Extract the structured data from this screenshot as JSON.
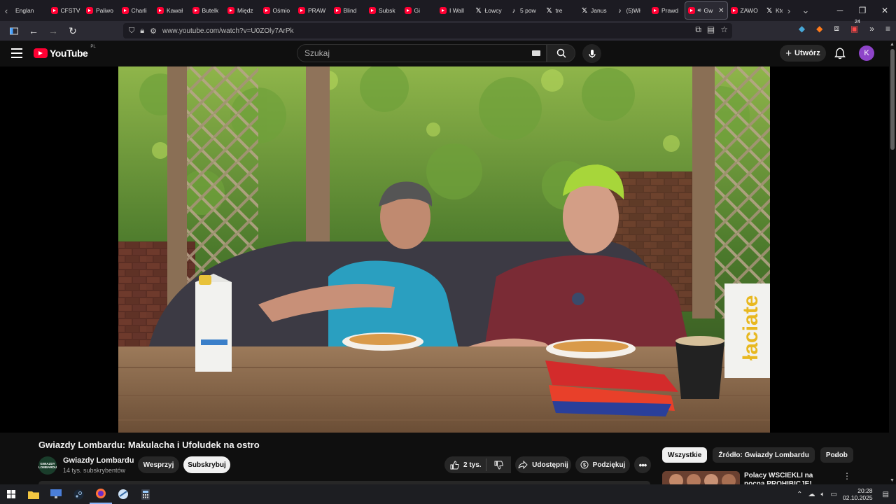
{
  "browser": {
    "tabs": [
      {
        "label": "Englan",
        "icon": "nav-back-icon"
      },
      {
        "label": "CFSTV",
        "icon": "youtube-icon"
      },
      {
        "label": "Paliwo",
        "icon": "youtube-icon"
      },
      {
        "label": "Charli",
        "icon": "youtube-icon"
      },
      {
        "label": "Kawał",
        "icon": "youtube-icon"
      },
      {
        "label": "Butelk",
        "icon": "youtube-icon"
      },
      {
        "label": "Międz",
        "icon": "youtube-icon"
      },
      {
        "label": "Ośmio",
        "icon": "youtube-icon"
      },
      {
        "label": "PRAW",
        "icon": "youtube-icon"
      },
      {
        "label": "Blind",
        "icon": "youtube-icon"
      },
      {
        "label": "Subsk",
        "icon": "youtube-icon"
      },
      {
        "label": "Gi",
        "icon": "youtube-icon"
      },
      {
        "label": "I Wall",
        "icon": "youtube-icon"
      },
      {
        "label": "Łowcy",
        "icon": "x-icon"
      },
      {
        "label": "5 pow",
        "icon": "tiktok-icon"
      },
      {
        "label": "tre",
        "icon": "x-icon"
      },
      {
        "label": "Janus",
        "icon": "x-icon"
      },
      {
        "label": "(5)Wł",
        "icon": "tiktok-icon"
      },
      {
        "label": "Prawd",
        "icon": "youtube-icon"
      },
      {
        "label": "Gw",
        "icon": "youtube-icon",
        "active": true
      },
      {
        "label": "ZAWO",
        "icon": "youtube-icon"
      },
      {
        "label": "Kto",
        "icon": "x-icon"
      }
    ],
    "url": "www.youtube.com/watch?v=U0ZOly7ArPk",
    "extension_badge": "24"
  },
  "youtube": {
    "logo_text": "YouTube",
    "region": "PL",
    "search_placeholder": "Szukaj",
    "create_label": "Utwórz",
    "avatar_letter": "K"
  },
  "video": {
    "title": "Gwiazdy Lombardu: Makulacha i Ufoludek na ostro",
    "channel": {
      "name": "Gwiazdy Lombardu",
      "subscribers": "14 tys. subskrybentów",
      "avatar_text": "GWIAZDY LOMBARDU"
    },
    "join_label": "Wesprzyj",
    "subscribe_label": "Subskrybuj",
    "likes": "2 tys.",
    "share_label": "Udostępnij",
    "thanks_label": "Podziękuj",
    "scene": {
      "carton_label": "łaciate"
    }
  },
  "sidebar": {
    "chips": [
      "Wszystkie",
      "Źródło: Gwiazdy Lombardu",
      "Podob"
    ],
    "recommendation_title": "Polacy WŚCIEKLI na nocną PROHIBICJĘ! POLSKA nie"
  },
  "taskbar": {
    "time": "20:28",
    "date": "02.10.2025"
  },
  "colors": {
    "youtube_red": "#ff0033",
    "background": "#0f0f0f",
    "avatar": "#8e44c9"
  }
}
